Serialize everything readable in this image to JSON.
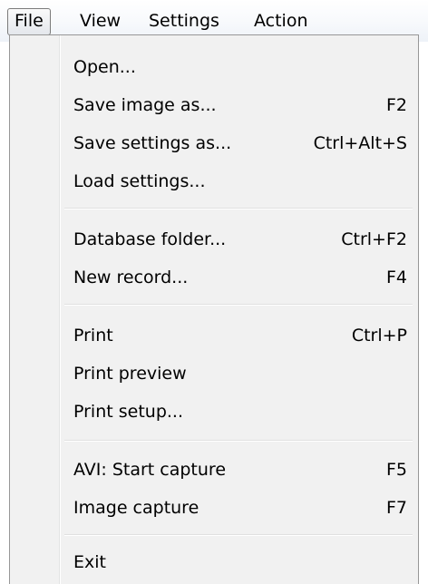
{
  "menubar": {
    "items": [
      {
        "label": "File",
        "active": true
      },
      {
        "label": "View",
        "active": false
      },
      {
        "label": "Settings",
        "active": false
      },
      {
        "label": "Action",
        "active": false
      }
    ]
  },
  "file_menu": {
    "items": [
      {
        "label": "Open...",
        "shortcut": ""
      },
      {
        "label": "Save image as...",
        "shortcut": "F2"
      },
      {
        "label": "Save settings as...",
        "shortcut": "Ctrl+Alt+S"
      },
      {
        "label": "Load settings...",
        "shortcut": ""
      },
      {
        "label": "Database folder...",
        "shortcut": "Ctrl+F2"
      },
      {
        "label": "New record...",
        "shortcut": "F4"
      },
      {
        "label": "Print",
        "shortcut": "Ctrl+P"
      },
      {
        "label": "Print preview",
        "shortcut": ""
      },
      {
        "label": "Print setup...",
        "shortcut": ""
      },
      {
        "label": "AVI: Start capture",
        "shortcut": "F5"
      },
      {
        "label": "Image capture",
        "shortcut": "F7"
      },
      {
        "label": "Exit",
        "shortcut": ""
      }
    ]
  },
  "colors": {
    "menu_background": "#f1f1f1",
    "menu_border": "#979797",
    "active_item_border": "#7b7b7b",
    "text": "#000000"
  }
}
